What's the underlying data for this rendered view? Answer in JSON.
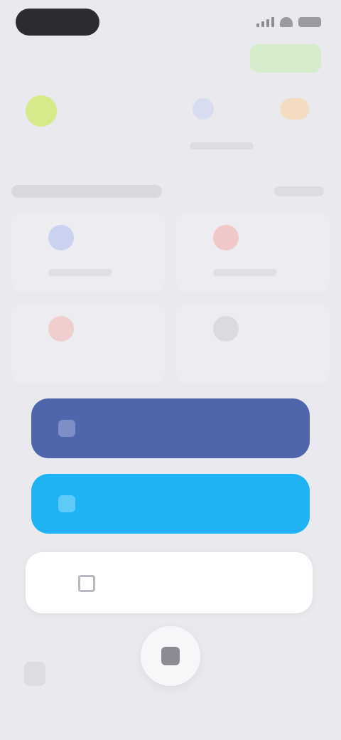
{
  "colors": {
    "background": "#e9e9ee",
    "facebook": "#4f66ad",
    "twitter": "#1fb3f5",
    "email_bg": "#ffffff",
    "badge": "#d5eccd"
  },
  "quick_actions": [
    {
      "icon": "circle-icon",
      "color": "#d6ea8a"
    },
    {
      "icon": "circle-icon",
      "color": "#d7dcf0"
    },
    {
      "icon": "circle-icon",
      "color": "#f3dcc0"
    }
  ],
  "shortcuts": [
    {
      "icon": "circle-icon",
      "color": "#c9d3f0"
    },
    {
      "icon": "circle-icon",
      "color": "#f1c8c8"
    },
    {
      "icon": "circle-icon",
      "color": "#f0cece"
    },
    {
      "icon": "circle-icon",
      "color": "#dadae0"
    }
  ],
  "buttons": {
    "facebook": {
      "icon": "facebook-icon"
    },
    "twitter": {
      "icon": "twitter-icon"
    },
    "email": {
      "icon": "mail-icon"
    }
  }
}
